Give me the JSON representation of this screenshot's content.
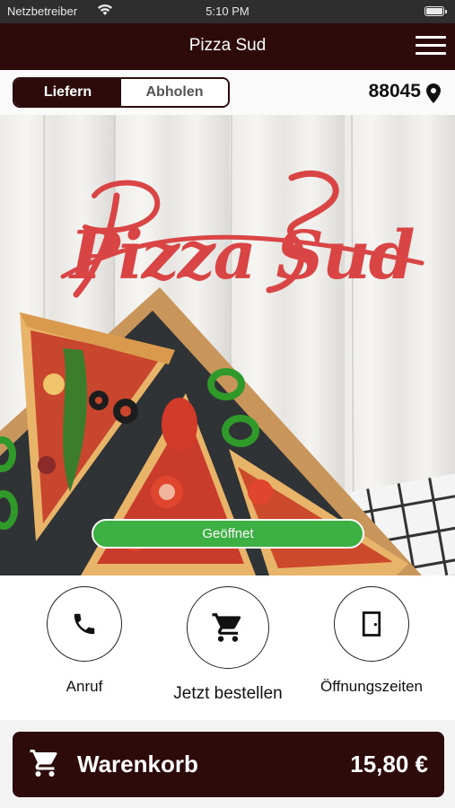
{
  "status_bar": {
    "carrier": "Netzbetreiber",
    "time": "5:10 PM"
  },
  "nav": {
    "title": "Pizza Sud"
  },
  "order_mode": {
    "options": [
      "Liefern",
      "Abholen"
    ],
    "selected": "Liefern"
  },
  "location": {
    "zip": "88045"
  },
  "hero": {
    "logo_text": "Pizza Sud",
    "open_status": "Geöffnet"
  },
  "actions": [
    {
      "label": "Anruf",
      "icon": "phone-icon"
    },
    {
      "label": "Jetzt bestellen",
      "icon": "cart-icon"
    },
    {
      "label": "Öffnungszeiten",
      "icon": "door-icon"
    }
  ],
  "cart": {
    "label": "Warenkorb",
    "total": "15,80 €"
  },
  "colors": {
    "brand_dark": "#2e0b0b",
    "open_green": "#3cb043",
    "logo_red": "#d94545"
  }
}
